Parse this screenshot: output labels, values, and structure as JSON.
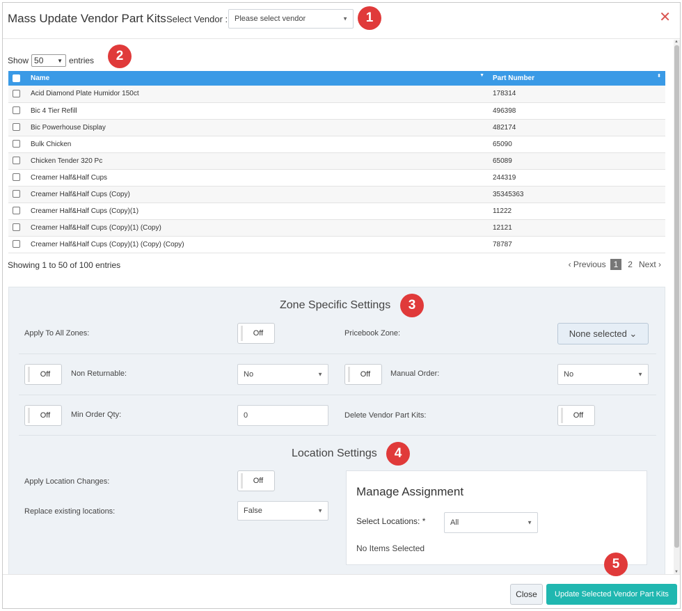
{
  "header": {
    "title": "Mass Update Vendor Part Kits",
    "vendor_label": "Select Vendor :",
    "vendor_placeholder": "Please select vendor",
    "close_glyph": "✕"
  },
  "badges": [
    "1",
    "2",
    "3",
    "4",
    "5"
  ],
  "length_menu": {
    "show": "Show",
    "value": "50",
    "entries": "entries"
  },
  "table": {
    "columns": [
      "Name",
      "Part Number"
    ],
    "rows": [
      {
        "name": "Acid Diamond Plate Humidor 150ct",
        "part": "178314"
      },
      {
        "name": "Bic 4 Tier Refill",
        "part": "496398"
      },
      {
        "name": "Bic Powerhouse Display",
        "part": "482174"
      },
      {
        "name": "Bulk Chicken",
        "part": "65090"
      },
      {
        "name": "Chicken Tender 320 Pc",
        "part": "65089"
      },
      {
        "name": "Creamer Half&Half Cups",
        "part": "244319"
      },
      {
        "name": "Creamer Half&Half Cups (Copy)",
        "part": "35345363"
      },
      {
        "name": "Creamer Half&Half Cups (Copy)(1)",
        "part": "11222"
      },
      {
        "name": "Creamer Half&Half Cups (Copy)(1) (Copy)",
        "part": "12121"
      },
      {
        "name": "Creamer Half&Half Cups (Copy)(1) (Copy) (Copy)",
        "part": "78787"
      }
    ]
  },
  "table_info": "Showing 1 to 50 of 100 entries",
  "pager": {
    "previous": "‹ Previous",
    "pages": [
      "1",
      "2"
    ],
    "next": "Next ›"
  },
  "zone": {
    "title": "Zone Specific Settings",
    "apply_all_label": "Apply To All Zones:",
    "apply_all_toggle": "Off",
    "pricebook_label": "Pricebook Zone:",
    "pricebook_value": "None selected ⌄",
    "non_returnable_toggle": "Off",
    "non_returnable_label": "Non Returnable:",
    "non_returnable_value": "No",
    "manual_order_toggle": "Off",
    "manual_order_label": "Manual Order:",
    "manual_order_value": "No",
    "min_order_toggle": "Off",
    "min_order_label": "Min Order Qty:",
    "min_order_value": "0",
    "delete_label": "Delete Vendor Part Kits:",
    "delete_toggle": "Off"
  },
  "location": {
    "title": "Location Settings",
    "apply_label": "Apply Location Changes:",
    "apply_toggle": "Off",
    "replace_label": "Replace existing locations:",
    "replace_value": "False",
    "assign_title": "Manage Assignment",
    "select_label": "Select Locations: *",
    "select_value": "All",
    "none_selected": "No Items Selected"
  },
  "footer": {
    "close": "Close",
    "update": "Update Selected Vendor Part Kits"
  }
}
